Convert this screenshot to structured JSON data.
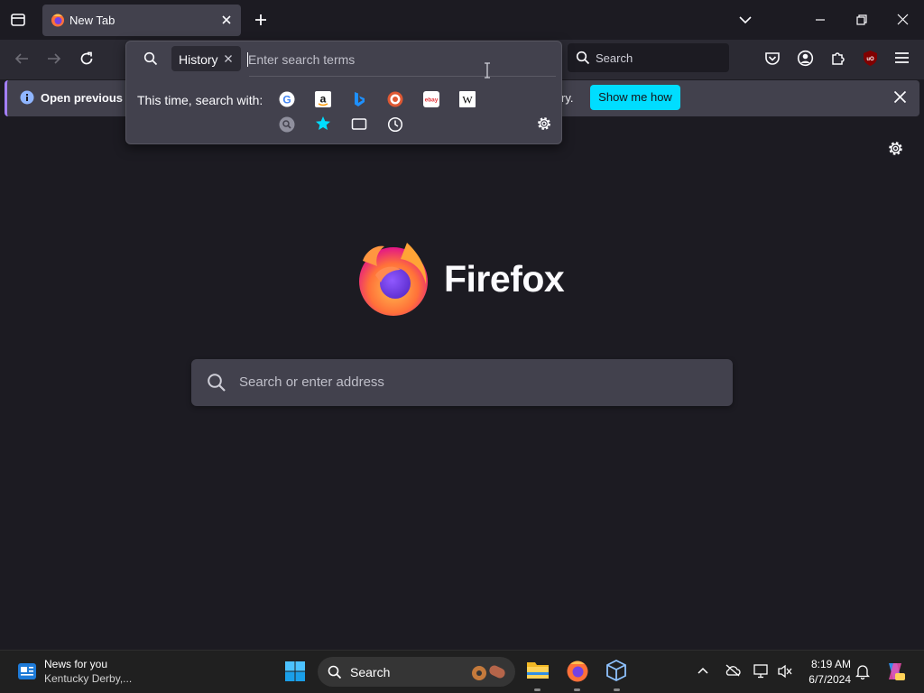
{
  "tab": {
    "title": "New Tab"
  },
  "search_popup": {
    "chip_label": "History",
    "input_placeholder": "Enter search terms",
    "search_with_label": "This time, search with:"
  },
  "notification": {
    "text_left": "Open previous tab",
    "text_right": "ry.",
    "button_label": "Show me how"
  },
  "toolbar": {
    "search_placeholder": "Search"
  },
  "newtab": {
    "brand": "Firefox",
    "search_placeholder": "Search or enter address"
  },
  "taskbar": {
    "news_title": "News for you",
    "news_subtitle": "Kentucky Derby,...",
    "search_label": "Search",
    "time": "8:19 AM",
    "date": "6/7/2024"
  },
  "colors": {
    "accent": "#00ddff",
    "tab_active": "#42414d",
    "toolbar": "#2b2a33",
    "background": "#1c1b22"
  }
}
